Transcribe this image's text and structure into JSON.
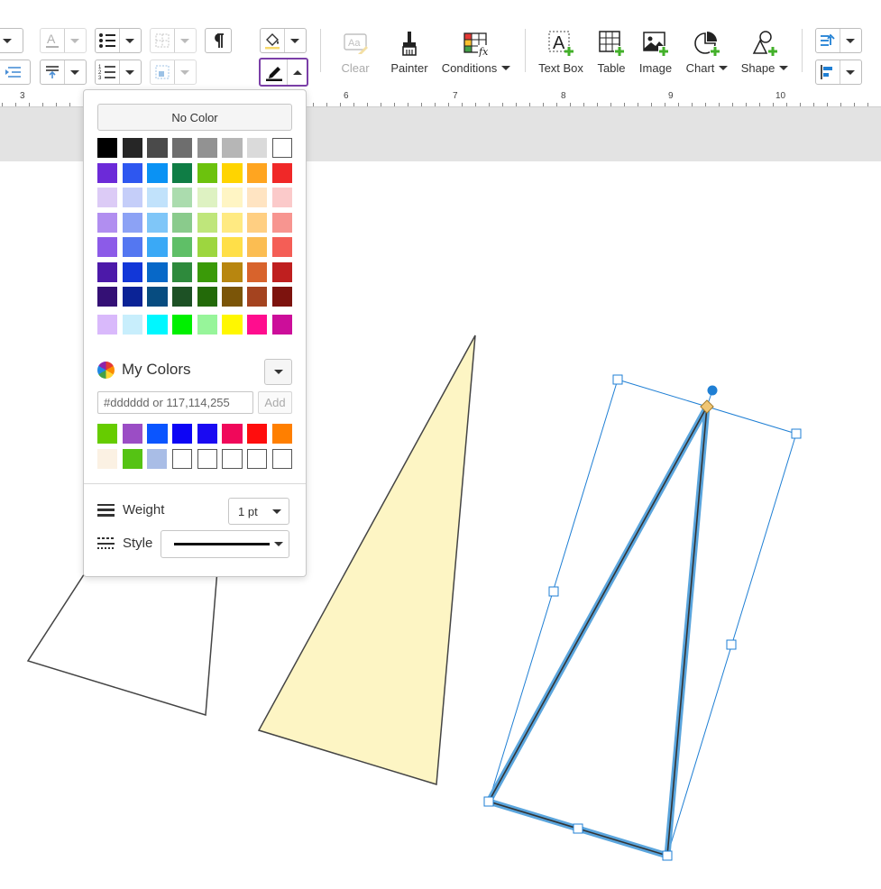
{
  "toolbar": {
    "buttons": {
      "clear": "Clear",
      "painter": "Painter",
      "conditions": "Conditions",
      "text_box": "Text Box",
      "table": "Table",
      "image": "Image",
      "chart": "Chart",
      "shape": "Shape"
    },
    "active_color": "#7b3fa8"
  },
  "ruler": {
    "labels": [
      "3",
      "6",
      "7",
      "8",
      "9",
      "10"
    ]
  },
  "color_popup": {
    "no_color_label": "No Color",
    "palette": [
      [
        "#000000",
        "#262626",
        "#4a4a4a",
        "#6e6e6e",
        "#929292",
        "#b6b6b6",
        "#dadada",
        "#ffffff"
      ],
      [
        "#6c2ad8",
        "#2e57f0",
        "#0a92f4",
        "#0f7d45",
        "#6cc20d",
        "#ffd400",
        "#ffa520",
        "#f02828"
      ],
      [
        "#dccbf6",
        "#c5cef9",
        "#c1e2fb",
        "#abdcae",
        "#def2c2",
        "#fff5c4",
        "#ffe4c2",
        "#fbcaca"
      ],
      [
        "#b18ef0",
        "#8ca2f5",
        "#7fc6f8",
        "#8acb8c",
        "#bfe67b",
        "#ffea82",
        "#ffcf82",
        "#f79590"
      ],
      [
        "#8c5be8",
        "#5477f1",
        "#3aa9f6",
        "#5fbf67",
        "#9dd63f",
        "#ffdf48",
        "#fbbd52",
        "#f45e56"
      ],
      [
        "#4c19a9",
        "#1237d8",
        "#0768c8",
        "#2e8a3c",
        "#3a9a08",
        "#b8860f",
        "#d8632c",
        "#bf1f1f"
      ],
      [
        "#341075",
        "#0b2396",
        "#074c80",
        "#1d5125",
        "#236a09",
        "#7b5508",
        "#a4431f",
        "#7d130e"
      ],
      [
        "#d9b9fb",
        "#c8eefc",
        "#00f7ff",
        "#00f000",
        "#97f59a",
        "#fff700",
        "#ff0d8e",
        "#cc0e9a"
      ]
    ],
    "my_colors_title": "My Colors",
    "hex_placeholder": "#dddddd or 117,114,255",
    "add_label": "Add",
    "my_colors": [
      [
        "#66cc00",
        "#9b4dc5",
        "#0a55ff",
        "#0d05f5",
        "#1a0af2",
        "#f0085a",
        "#ff0d0d",
        "#ff7f00"
      ],
      [
        "#fbf1e3",
        "#55c314",
        "#a9bde6",
        "",
        "",
        "",
        "",
        ""
      ]
    ],
    "weight_label": "Weight",
    "weight_value": "1 pt",
    "style_label": "Style"
  },
  "canvas": {
    "triangle_fill": "#fdf5c4",
    "selection_color": "#1f7fd4",
    "selected_stroke_glow": "#5aa5dd"
  }
}
